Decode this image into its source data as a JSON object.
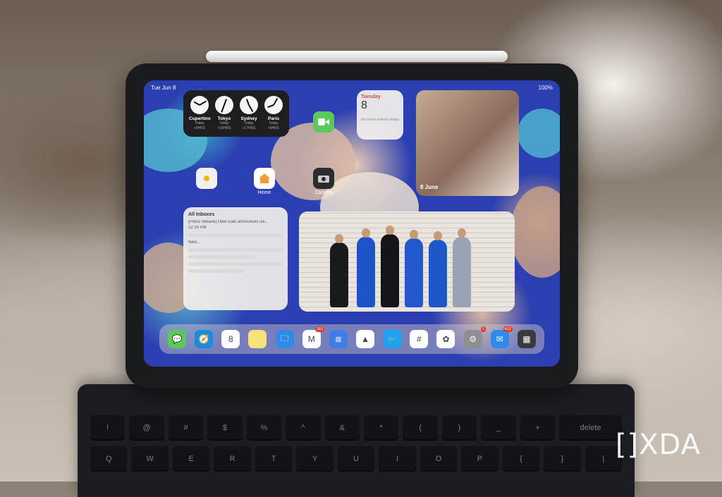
{
  "status_bar": {
    "date": "Tue Jun 8",
    "battery": "100%"
  },
  "world_clock": [
    {
      "city": "Cupertino",
      "day": "Today",
      "offset": "+0HRS"
    },
    {
      "city": "Tokyo",
      "day": "Today",
      "offset": "+16HRS"
    },
    {
      "city": "Sydney",
      "day": "Today",
      "offset": "+17HRS"
    },
    {
      "city": "Paris",
      "day": "Today",
      "offset": "+9HRS"
    }
  ],
  "calendar": {
    "weekday": "Tuesday",
    "day": "8",
    "note": "No more events today"
  },
  "facetime_label": "FaceTime",
  "home_label": "Home",
  "camera_label": "Camera",
  "photos_widget": {
    "date": "8 June"
  },
  "mail_widget": {
    "title": "All Inboxes",
    "items": [
      {
        "subject": "[Press release] Uber Eats announces De...",
        "time": "12:14 PM"
      },
      {
        "subject": "New...",
        "time": ""
      }
    ]
  },
  "calendar_dock_day": "8",
  "dock": [
    {
      "name": "Messages",
      "icon": "messages-icon",
      "color": "#5ac85a",
      "glyph": "💬",
      "badge": ""
    },
    {
      "name": "Safari",
      "icon": "safari-icon",
      "color": "#1e88e5",
      "glyph": "🧭",
      "badge": ""
    },
    {
      "name": "Calendar",
      "icon": "calendar-icon",
      "color": "#ffffff",
      "glyph": "8",
      "badge": ""
    },
    {
      "name": "Notes",
      "icon": "notes-icon",
      "color": "#f6e27a",
      "glyph": "",
      "badge": ""
    },
    {
      "name": "Files",
      "icon": "files-icon",
      "color": "#2f8ae8",
      "glyph": "🗀",
      "badge": ""
    },
    {
      "name": "Gmail",
      "icon": "gmail-icon",
      "color": "#ffffff",
      "glyph": "M",
      "badge": "163"
    },
    {
      "name": "Docs",
      "icon": "docs-icon",
      "color": "#3f7ee8",
      "glyph": "≣",
      "badge": ""
    },
    {
      "name": "Drive",
      "icon": "drive-icon",
      "color": "#ffffff",
      "glyph": "▲",
      "badge": ""
    },
    {
      "name": "Twitter",
      "icon": "twitter-icon",
      "color": "#1da1f2",
      "glyph": "🐦",
      "badge": ""
    },
    {
      "name": "Slack",
      "icon": "slack-icon",
      "color": "#ffffff",
      "glyph": "#",
      "badge": ""
    },
    {
      "name": "Photos",
      "icon": "photos-icon",
      "color": "#ffffff",
      "glyph": "✿",
      "badge": ""
    },
    {
      "name": "Settings",
      "icon": "settings-icon",
      "color": "#8e8e93",
      "glyph": "⚙",
      "badge": "1"
    },
    {
      "name": "Mail",
      "icon": "mail-icon",
      "color": "#2f8ae8",
      "glyph": "✉",
      "badge": "412"
    },
    {
      "name": "App Library",
      "icon": "app-library-icon",
      "color": "#3a3a3c",
      "glyph": "▦",
      "badge": ""
    }
  ],
  "keyboard": {
    "row1": [
      "!",
      "@",
      "#",
      "$",
      "%",
      "^",
      "&",
      "*",
      "(",
      ")",
      "_",
      "+",
      "delete"
    ],
    "row2": [
      "Q",
      "W",
      "E",
      "R",
      "T",
      "Y",
      "U",
      "I",
      "O",
      "P",
      "{",
      "}",
      "|"
    ]
  },
  "watermark": "[]XDA"
}
